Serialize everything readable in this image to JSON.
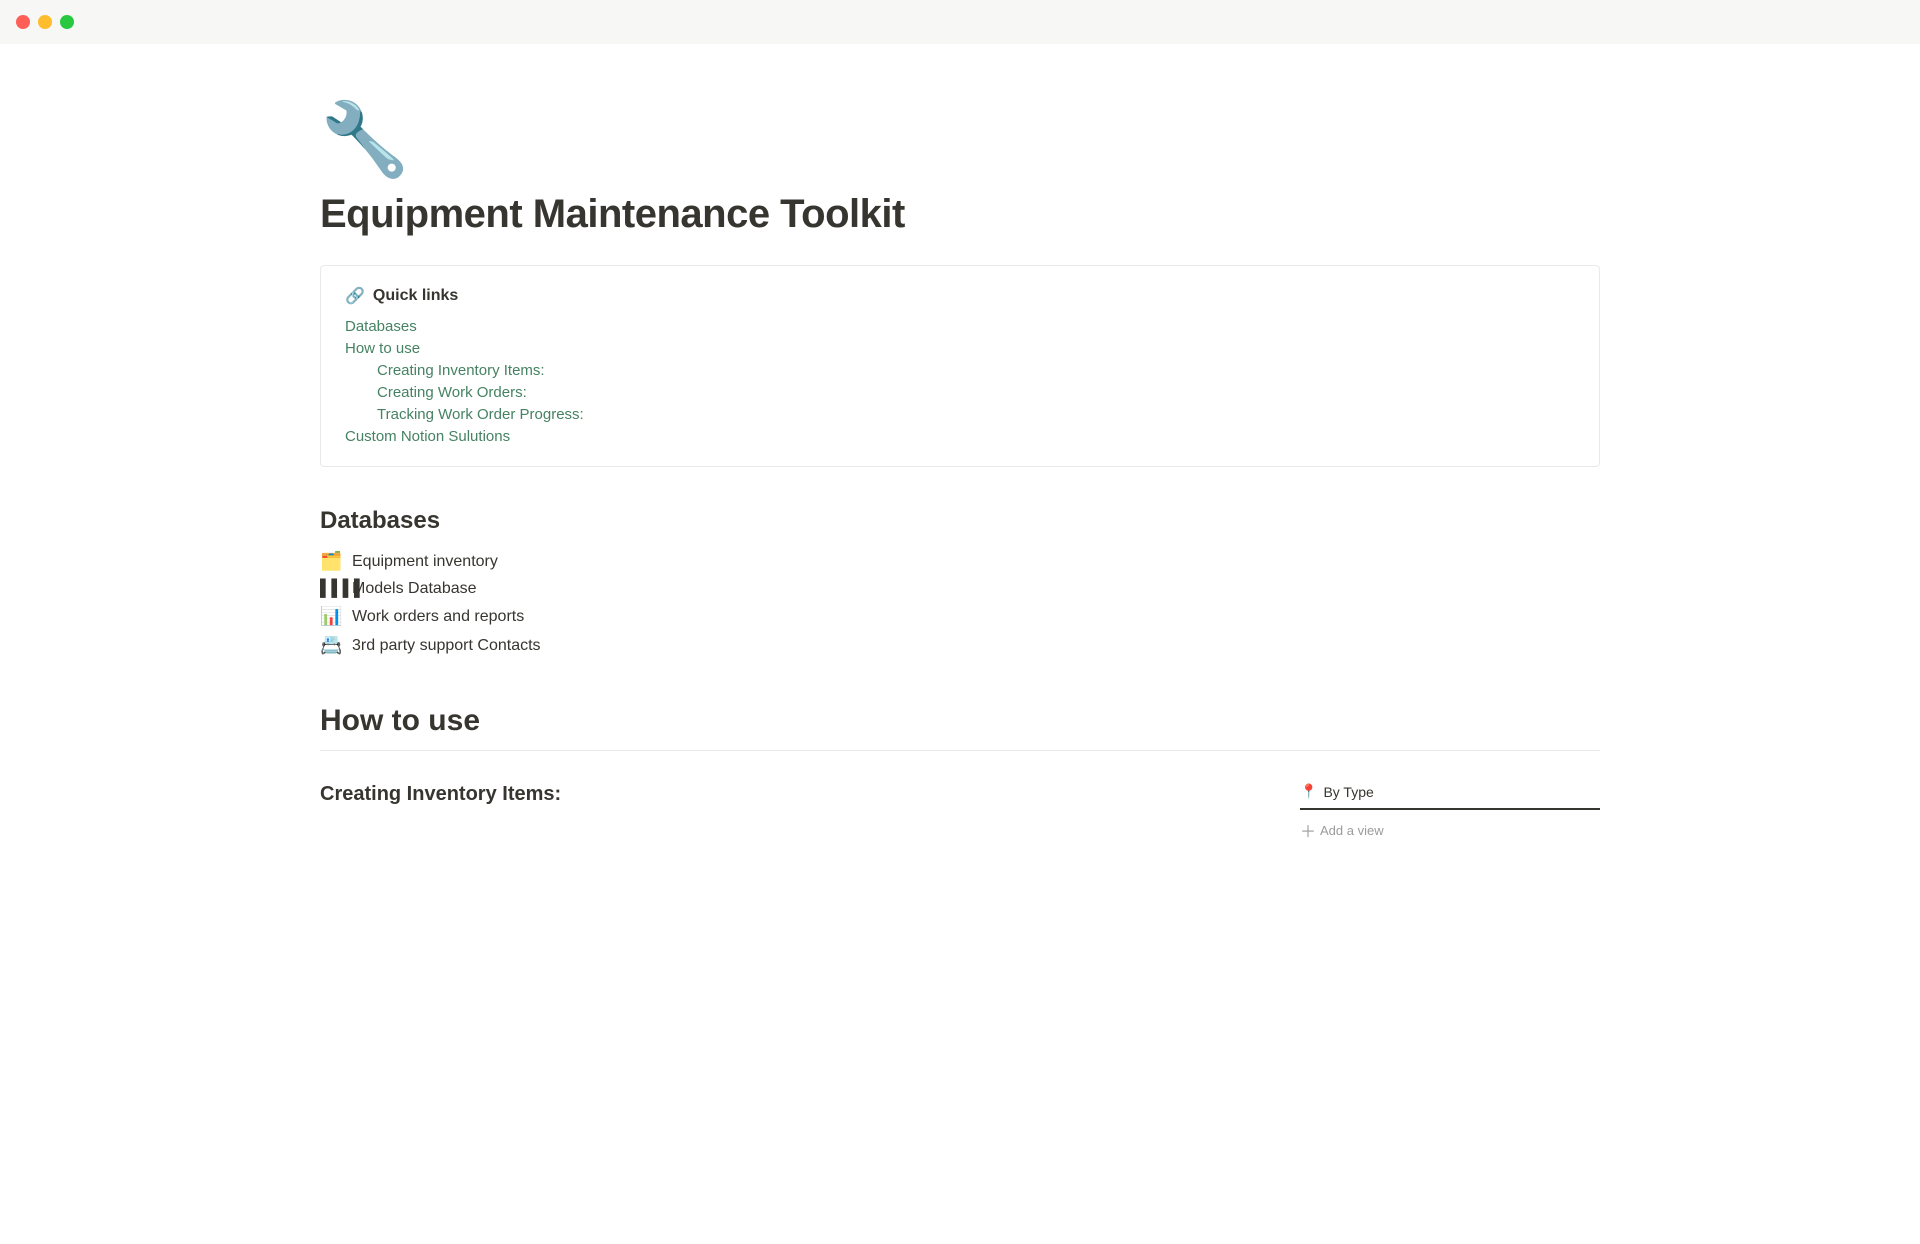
{
  "titlebar": {
    "traffic_lights": [
      "red",
      "yellow",
      "green"
    ]
  },
  "page": {
    "icon": "🔧",
    "title": "Equipment Maintenance Toolkit",
    "quick_links": {
      "header": "Quick links",
      "chain_symbol": "🔗",
      "links": [
        {
          "label": "Databases",
          "indent": false
        },
        {
          "label": "How to use",
          "indent": false
        },
        {
          "label": "Creating Inventory Items:",
          "indent": true
        },
        {
          "label": "Creating Work Orders:",
          "indent": true
        },
        {
          "label": "Tracking Work Order Progress:",
          "indent": true
        },
        {
          "label": "Custom Notion Sulutions",
          "indent": false
        }
      ]
    },
    "databases_section": {
      "heading": "Databases",
      "items": [
        {
          "icon": "🗂️",
          "label": "Equipment inventory"
        },
        {
          "icon": "▦",
          "label": "Models Database"
        },
        {
          "icon": "📊",
          "label": "Work orders and reports"
        },
        {
          "icon": "📇",
          "label": "3rd party support Contacts"
        }
      ]
    },
    "how_to_use_section": {
      "heading": "How to use",
      "creating_inventory": {
        "title": "Creating Inventory Items:",
        "by_type_label": "By Type"
      }
    }
  }
}
